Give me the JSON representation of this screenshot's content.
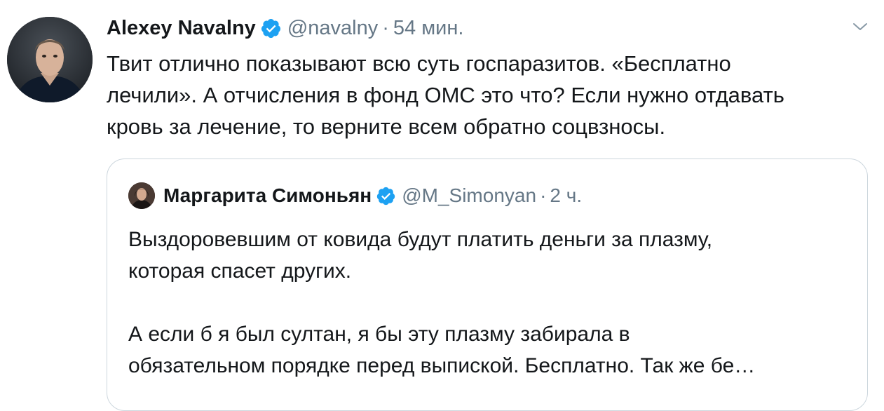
{
  "tweet": {
    "display_name": "Alexey Navalny",
    "handle": "@navalny",
    "separator": "·",
    "time": "54 мин.",
    "text_lines": [
      "Твит отлично показывают всю суть госпаразитов. «Бесплатно",
      "лечили». А отчисления в фонд ОМС это что? Если нужно отдавать",
      "кровь за лечение, то верните всем обратно соцвзносы."
    ],
    "avatar_icon": "user-photo",
    "verified_icon": "verified-badge-icon",
    "menu_icon": "chevron-down-icon"
  },
  "quote": {
    "display_name": "Маргарита Симоньян",
    "handle": "@M_Simonyan",
    "separator": "·",
    "time": "2 ч.",
    "paragraph1": [
      "Выздоровевшим от ковида будут платить деньги за плазму,",
      "которая спасет других."
    ],
    "paragraph2": [
      "А если б я был султан, я бы эту плазму забирала в",
      "обязательном порядке перед выпиской. Бесплатно. Так же бе…"
    ]
  },
  "colors": {
    "text": "#14171a",
    "secondary": "#657786",
    "verified": "#1da1f2",
    "border": "#ccd6dd"
  }
}
